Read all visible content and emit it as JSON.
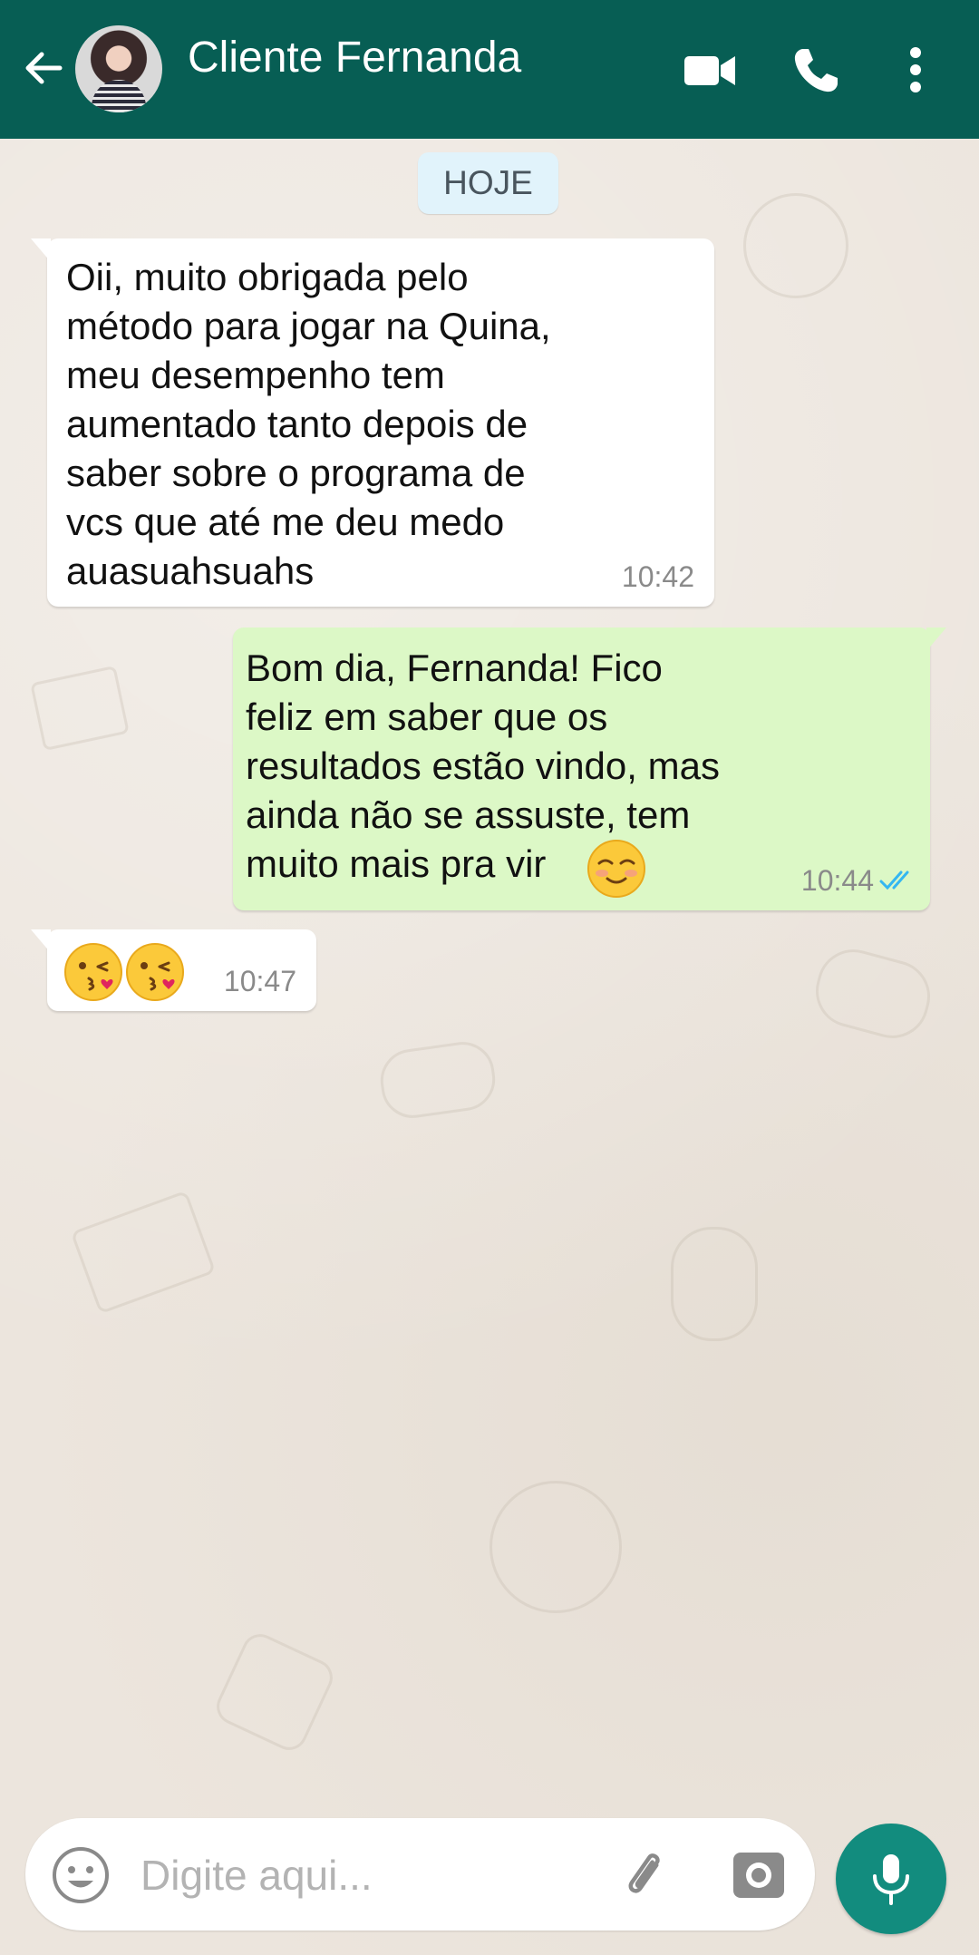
{
  "header": {
    "contact_name": "Cliente Fernanda"
  },
  "chat": {
    "day_label": "HOJE",
    "messages": [
      {
        "direction": "incoming",
        "text": "Oii, muito obrigada pelo\nmétodo para jogar na Quina,\nmeu desempenho tem\naumentado tanto depois de\nsaber sobre o programa de\nvcs que até me deu medo\nauasuahsuahs",
        "time": "10:42"
      },
      {
        "direction": "outgoing",
        "text": "Bom dia, Fernanda! Fico\nfeliz em saber que os\nresultados estão vindo, mas\nainda não se assuste, tem\nmuito mais pra vir",
        "emoji": "smiling-face-emoji",
        "time": "10:44",
        "status": "read-double-check"
      },
      {
        "direction": "incoming",
        "emojis": [
          "kissing-face-emoji",
          "kissing-face-emoji"
        ],
        "time": "10:47"
      }
    ]
  },
  "composer": {
    "placeholder": "Digite aqui..."
  },
  "colors": {
    "header": "#075e54",
    "outgoing_bubble": "#dcf8c6",
    "incoming_bubble": "#ffffff",
    "mic_button": "#128c7e",
    "read_ticks": "#34b7f1"
  }
}
